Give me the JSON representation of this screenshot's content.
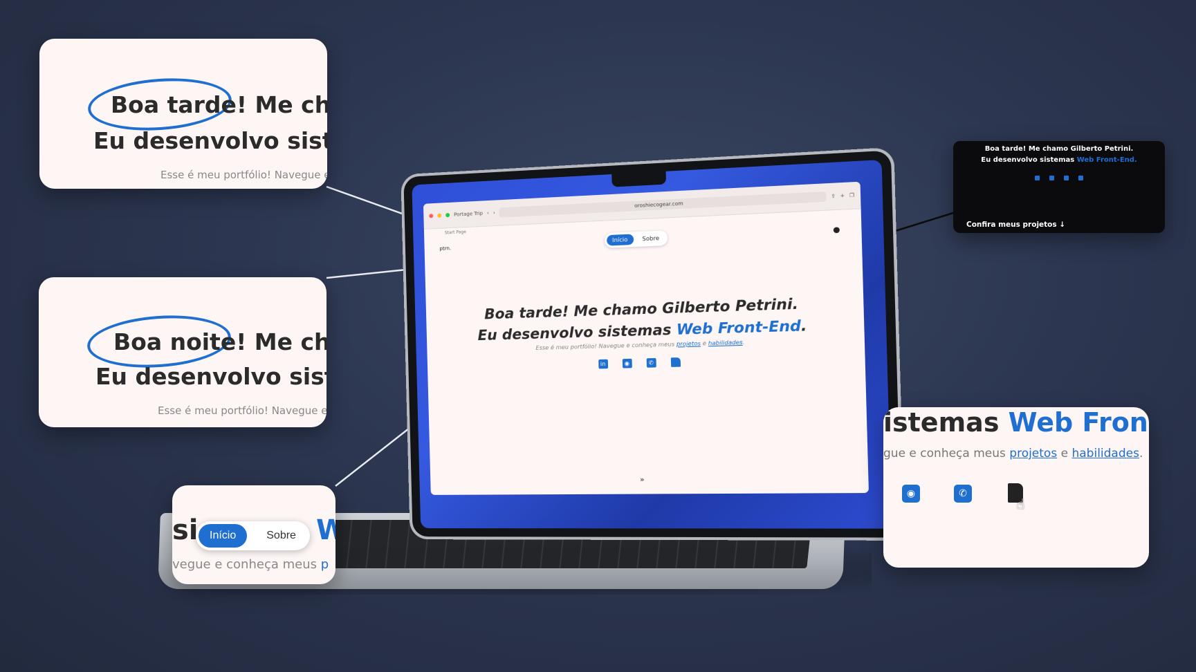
{
  "browser": {
    "tab_title": "Portage Trip",
    "url": "oroshiecogear.com",
    "bookmark": "Start Page"
  },
  "site": {
    "logo": "ptrn.",
    "nav": {
      "active": "Início",
      "other": "Sobre"
    },
    "hero": {
      "line1": "Boa tarde! Me chamo Gilberto Petrini.",
      "line2_prefix": "Eu desenvolvo sistemas ",
      "line2_highlight": "Web Front-End",
      "line2_suffix": ".",
      "sub_prefix": "Esse é meu portfólio! Navegue e conheça meus ",
      "link1": "projetos",
      "sub_mid": " e ",
      "link2": "habilidades",
      "sub_suffix": "."
    },
    "icons": [
      "linkedin-icon",
      "github-icon",
      "whatsapp-icon",
      "document-icon"
    ],
    "scroll_hint": "»"
  },
  "callouts": {
    "tarde": {
      "greeting": "Boa tarde!",
      "rest": " Me cha",
      "line2": "Eu desenvolvo siste",
      "sub": "Esse é meu portfólio! Navegue e"
    },
    "noite": {
      "greeting": "Boa noite!",
      "rest": " Me cha",
      "line2": "Eu desenvolvo siste",
      "sub": "Esse é meu portfólio! Navegue e c"
    },
    "dark": {
      "line1": "Boa tarde! Me chamo Gilberto Petrini.",
      "line2_prefix": "Eu desenvolvo sistemas ",
      "line2_highlight": "Web Front-End.",
      "cta": "Confira meus projetos ↓"
    },
    "nav": {
      "left_fragment": "si",
      "right_fragment": "W",
      "active": "Início",
      "other": "Sobre",
      "sub": "vegue e conheça meus ",
      "link": "p"
    },
    "right": {
      "prefix": "istemas ",
      "highlight": "Web Front-",
      "sub_prefix": "gue e conheça meus ",
      "link1": "projetos",
      "mid": " e ",
      "link2": "habilidades",
      "end": "."
    }
  },
  "colors": {
    "accent": "#1f6fd1",
    "background": "#2c3650",
    "card": "#fdf6f5"
  }
}
